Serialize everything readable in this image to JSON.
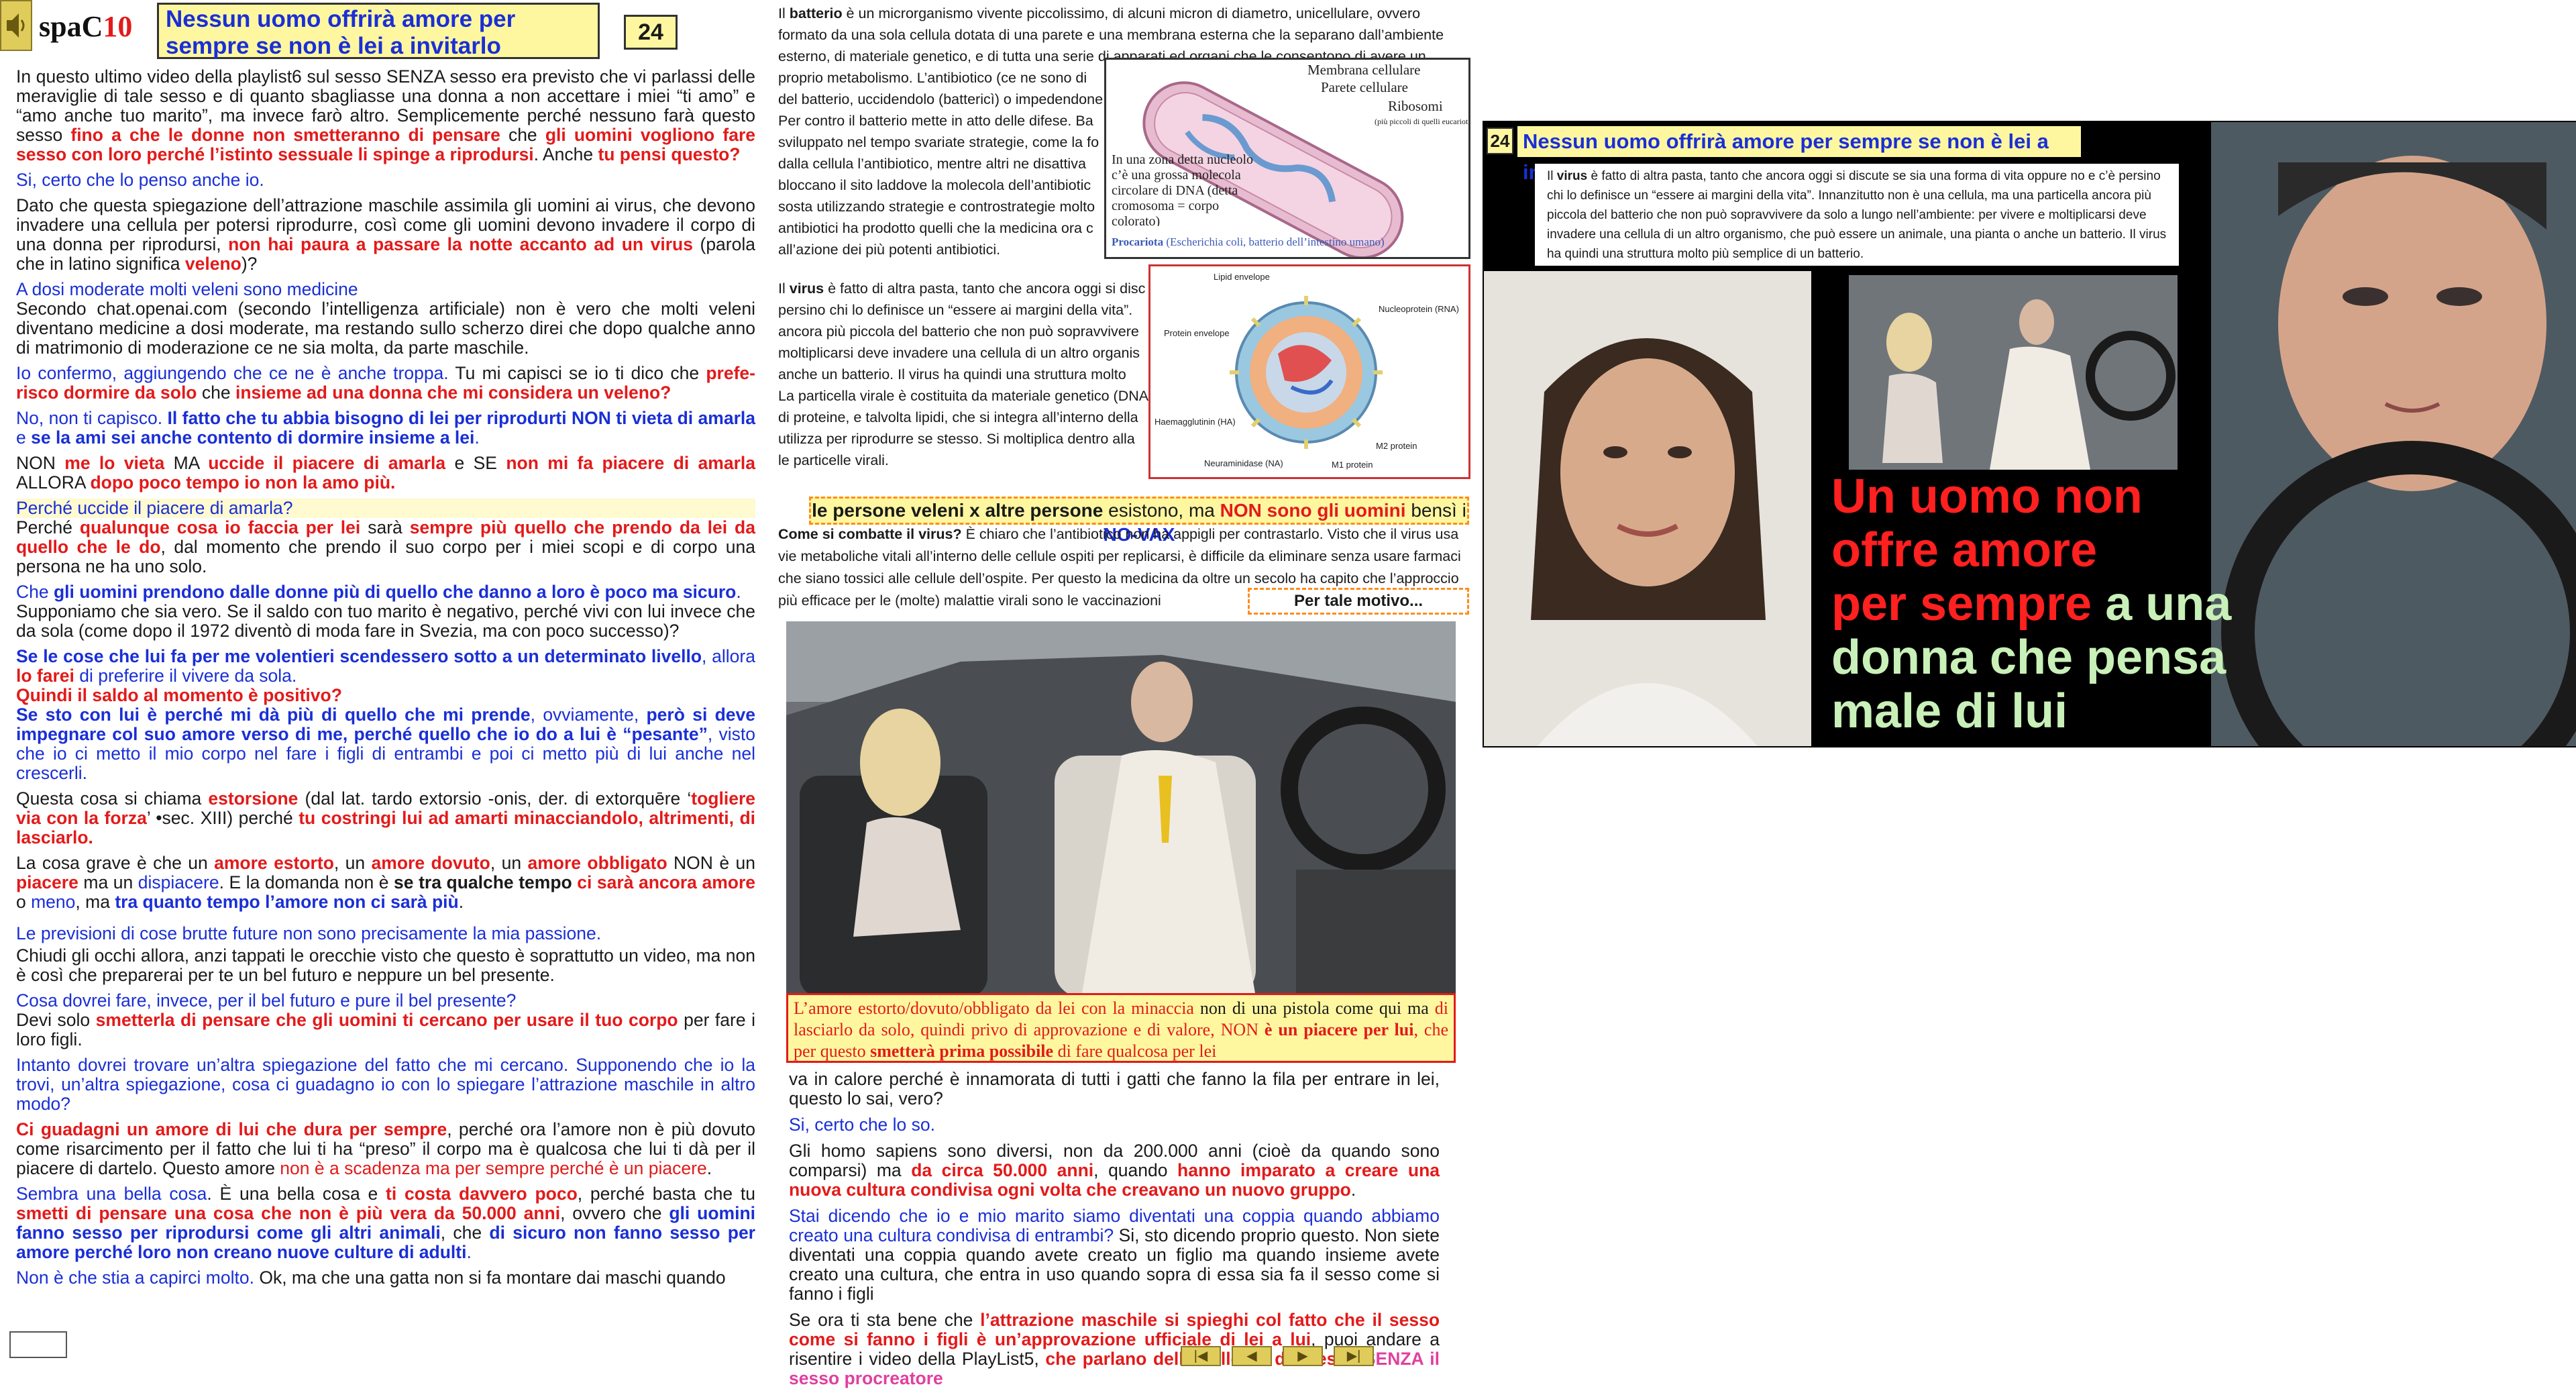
{
  "header": {
    "brand": "spaC",
    "brand_num": "10",
    "title": "Nessun uomo offrirà amore per sempre se non è lei a invitarlo",
    "page": "24"
  },
  "left": {
    "p1a": "In questo ultimo video della playlist6 sul sesso SENZA sesso era previsto che vi parlassi delle meraviglie di tale sesso e di quanto sbagliasse una donna a non accettare i miei “ti amo” e “amo anche tuo marito”, ma invece farò altro. Semplicemente perché nessuno farà questo sesso ",
    "p1b": "fino a che le donne non smetteranno di pensare",
    "p1c": " che ",
    "p1d": "gli uomini vogliono fare sesso con loro perché l’istinto sessuale li spinge a riprodursi",
    "p1e": ". Anche ",
    "p1f": "tu pensi questo?",
    "p2": "Si, certo che lo penso anche io.",
    "p3a": "Dato che questa spiegazione dell’attrazione maschile assimila gli uomini ai virus, che devono invadere una cellula per potersi riprodurre, così come gli uomini devono invadere il corpo di una donna per riprodursi, ",
    "p3b": "non hai paura a passare la notte accanto ad un virus",
    "p3c": " (parola che in latino significa ",
    "p3d": "veleno",
    "p3e": ")?",
    "p4": "A dosi moderate molti veleni sono medicine",
    "p5": "Secondo chat.openai.com (secondo l’intelligenza artificiale) non è vero che molti veleni diventano medicine a dosi moderate, ma restando sullo scherzo direi che dopo qualche anno di matrimonio di moderazione ce ne sia molta, da parte maschile.",
    "p6a": "Io confermo, aggiungendo che ce ne è anche troppa.",
    "p6b": " Tu mi capisci se io ti dico che ",
    "p6c": "prefe-risco dormire da solo",
    "p6d": " che ",
    "p6e": "insieme ad una donna che mi considera un veleno?",
    "p7a": "No, non ti capisco. ",
    "p7b": "Il fatto che tu abbia bisogno di lei per riprodurti NON ti vieta di amarla",
    "p7c": " e ",
    "p7d": "se la ami sei anche contento di dormire insieme a lei",
    "p7e": ".",
    "p8a": "NON ",
    "p8b": "me lo vieta",
    "p8c": " MA ",
    "p8d": "uccide il piacere di amarla",
    "p8e": " e SE ",
    "p8f": "non mi fa piacere di amarla",
    "p8g": " ALLORA ",
    "p8h": "dopo poco tempo io non la amo più.",
    "p9": "Perché uccide il piacere di amarla?",
    "p10a": "Perché ",
    "p10b": "qualunque cosa io faccia per lei",
    "p10c": " sarà ",
    "p10d": "sempre più quello che prendo da lei da quello che le do",
    "p10e": ", dal momento che prendo il suo corpo per i miei scopi e di corpo una persona ne ha uno solo.",
    "p11a": "Che ",
    "p11b": "gli uomini prendono dalle donne più di quello che danno a loro è poco ma sicuro",
    "p11c": ".",
    "p12": "Supponiamo che sia vero. Se il saldo con tuo marito è negativo, perché vivi con lui invece che da sola (come dopo il 1972 diventò di moda fare in Svezia, ma con poco successo)?",
    "p13a": "Se le cose che lui fa per me volentieri scendessero sotto a un determinato livello",
    "p13b": ", allora ",
    "p13c": "lo farei",
    "p13d": " di preferire il vivere da sola.",
    "p14": "Quindi il saldo al momento è positivo?",
    "p15a": "Se sto con lui è perché mi dà più di quello che mi prende",
    "p15b": ", ovviamente, ",
    "p15c": "però si deve impegnare col suo amore verso di me, perché quello che io do a lui è “pesante”",
    "p15d": ", visto che io ci metto il mio corpo nel fare i figli di entrambi e poi ci metto più di lui anche nel crescerli.",
    "p16a": "Questa cosa si chiama ",
    "p16b": "estorsione",
    "p16c": " (dal lat. tardo extorsio -onis, der. di extorquēre ‘",
    "p16d": "togliere via con la forza",
    "p16e": "’ •sec. XIII) perché ",
    "p16f": "tu costringi lui ad amarti minacciandolo, altrimenti, di lasciarlo.",
    "p17a": "La cosa grave è che un ",
    "p17b": "amore estorto",
    "p17c": ", un ",
    "p17d": "amore dovuto",
    "p17e": ", un ",
    "p17f": "amore obbligato",
    "p17g": " NON è un ",
    "p17h": "piacere",
    "p17i": " ma un ",
    "p17j": "dispiacere",
    "p17k": ". E la domanda non è ",
    "p17l": "se tra qualche tempo",
    "p17m": " ",
    "p17n": "ci sarà ancora amore",
    "p17o": " o ",
    "p17p": "meno",
    "p17q": ", ma ",
    "p17r": "tra quanto tempo l’amore non ci sarà più",
    "p17s": ".",
    "p18": "Le previsioni di cose brutte future non sono precisamente la mia passione.",
    "p19": "Chiudi gli occhi allora, anzi tappati le orecchie visto che questo è soprattutto un video, ma non è così che preparerai per te un bel futuro e neppure un bel presente.",
    "p20": "Cosa dovrei fare, invece, per il bel futuro e pure il bel presente?",
    "p21a": "Devi solo ",
    "p21b": "smetterla di pensare che gli uomini ti cercano per usare il tuo corpo",
    "p21c": " per fare i loro figli.",
    "p22": "Intanto dovrei trovare un’altra spiegazione del fatto che mi cercano. Supponendo che io la trovi, un’altra spiegazione, cosa ci guadagno io con lo spiegare l’attrazione maschile in altro modo?",
    "p23a": "Ci guadagni un amore di lui che dura per sempre",
    "p23b": ", perché ora l’amore non è più dovuto come risarcimento per il fatto che lui ti ha “preso” il corpo ma è qualcosa che lui ti dà per il piacere di dartelo. Questo amore ",
    "p23c": "non è a scadenza ma per sempre perché è un piacere",
    "p23d": ".",
    "p24a": "Sembra una bella cosa",
    "p24b": ". È una bella cosa e ",
    "p24c": "ti costa davvero poco",
    "p24d": ", perché basta che tu ",
    "p24e": "smetti di pensare una cosa che non è più vera da 50.000 anni",
    "p24f": ", ovvero che ",
    "p24g": "gli uomini fanno sesso per riprodursi come gli altri animali",
    "p24h": ", che ",
    "p24i": "di sicuro non fanno sesso per amore perché loro non creano nuove culture di adulti",
    "p24j": ".",
    "p25a": "Non è che stia a capirci molto.",
    "p25b": " Ok, ma che una gatta non si fa montare dai maschi quando"
  },
  "middle": {
    "bact_a": "Il ",
    "bact_b": "batterio",
    "bact_c": " è un microrganismo vivente piccolissimo, di alcuni micron di diametro, unicellulare, ovvero formato da una sola cellula dotata di una parete e una membrana esterna che la separano dall’ambiente esterno, di materiale genetico, e di tutta una serie di apparati ed organi che le consentono di avere un proprio metabolismo. L’antibiotico (ce ne sono di",
    "bact_d": "del batterio, uccidendolo (battericì) o impedendone",
    "bact_e": "Per contro il batterio mette in atto delle difese. Ba",
    "bact_f": "sviluppato nel tempo svariate strategie, come la fo",
    "bact_g": "dalla cellula l’antibiotico, mentre altri ne disattiva",
    "bact_h": "bloccano il sito laddove la molecola dell’antibiotic",
    "bact_i": "sosta utilizzando strategie e controstrategie molto",
    "bact_j": "antibiotici ha prodotto quelli che la medicina ora c",
    "bact_k": "all’azione dei più potenti antibiotici.",
    "vir_a": "Il ",
    "vir_b": "virus",
    "vir_c": " è fatto di altra pasta, tanto che ancora oggi si disc",
    "vir_d": "persino chi lo definisce un “essere ai margini della vita”.",
    "vir_e": "ancora più piccola del batterio che non può sopravvivere",
    "vir_f": "moltiplicarsi deve invadere una cellula di un altro organis",
    "vir_g": "anche un batterio. Il virus ha quindi una struttura molto",
    "vir_h": "La particella virale è costituita da materiale genetico (DNA",
    "vir_i": "di proteine, e talvolta lipidi, che si integra all’interno della",
    "vir_j": "utilizza per riprodurre se stesso. Si moltiplica dentro alla",
    "vir_k": "le particelle virali.",
    "bact_fig": {
      "l1": "Membrana cellulare",
      "l2": "Parete cellulare",
      "l3": "Ribosomi",
      "l4": "(più piccoli di quelli eucarioti)",
      "l5": "In una zona detta nucleolo c’è una grossa molecola circolare  di DNA (detta cromosoma = corpo colorato)",
      "cap_a": "Procariota",
      "cap_b": " (Escherichia coli, batterio dell’intestino umano)"
    },
    "virus_fig": {
      "l1": "Lipid envelope",
      "l2": "Nucleoprotein (RNA)",
      "l3": "Protein envelope",
      "l4": "Haemagglutinin (HA)",
      "l5": "M2 protein",
      "l6": "Neuraminidase (NA)",
      "l7": "M1 protein"
    },
    "veleni_a": "le persone veleni x altre persone",
    "veleni_b": " esistono, ma ",
    "veleni_c": "NON sono gli uomini",
    "veleni_d": " bensì i ",
    "veleni_e": "NO-VAX",
    "comb_a": "Come si combatte il virus?",
    "comb_b": " È chiaro che l’antibiotico non ha appigli per contrastarlo. Visto che il virus usa vie metaboliche vitali all’interno delle cellule ospiti per replicarsi, è difficile da eliminare senza usare farmaci che siano tossici alle cellule dell’ospite. Per questo la medicina da oltre un secolo ha capito che l’approccio più efficace per le (molte) malattie virali sono le vaccinazioni",
    "tale": "Per tale motivo...",
    "cap_a": "L’amore estorto/dovuto/obbligato da lei con la minaccia",
    "cap_b": " non di una pistola come qui ma ",
    "cap_c": "di lasciarlo da solo, quindi privo di approvazione e di valore, NON ",
    "cap_d": "è un piacere per lui",
    "cap_e": ", che per questo ",
    "cap_f": "smetterà prima possibile",
    "cap_g": " di fare qualcosa per lei",
    "lo1": "va in calore perché è innamorata di tutti i gatti che fanno la fila per entrare in lei, questo lo sai, vero?",
    "lo2": "Si, certo che lo so.",
    "lo3a": "Gli homo sapiens sono diversi, non da 200.000 anni (cioè da quando sono comparsi) ma ",
    "lo3b": "da circa 50.000 anni",
    "lo3c": ", quando ",
    "lo3d": "hanno imparato a creare una nuova cultura condivisa  ogni volta che creavano un nuovo gruppo",
    "lo3e": ".",
    "lo4a": "Stai dicendo che io e mio marito siamo diventati una coppia quando abbiamo creato una cultura condivisa di entrambi?",
    "lo4b": " Si, sto dicendo proprio questo. Non siete diventati una coppia quando avete creato un figlio ma quando insieme avete creato una cultura, che entra in uso quando sopra di essa sia fa il sesso come si fanno i figli",
    "lo5a": "Se ora ti sta bene che ",
    "lo5b": "l’attrazione maschile si spieghi col fatto che il sesso come si fanno i figli è un’approvazione ufficiale di lei a lui",
    "lo5c": ", puoi andare a risentire i video della PlayList5, ",
    "lo5d": "che parlano delle bellezze del sesso ",
    "lo5e": "SENZA il sesso procreatore"
  },
  "thumb": {
    "num": "24",
    "title": "Nessun uomo offrirà amore per sempre se non è lei a invitarlo",
    "text_a": "Il ",
    "text_b": "virus",
    "text_c": " è fatto di altra pasta, tanto che ancora oggi si discute se sia una forma di vita oppure no e c’è persino chi lo definisce un “essere ai margini della vita”. Innanzitutto non è una cellula, ma una particella ancora più piccola del batterio che non può sopravvivere da solo a lungo nell’ambiente: per vivere e moltiplicarsi deve invadere una cellula di un altro organismo, che può essere un animale, una pianta o anche un batterio. Il virus ha quindi una struttura molto più semplice di un batterio.",
    "slogan_r1": "Un uomo non",
    "slogan_r2": "offre amore",
    "slogan_r3": "per sempre",
    "slogan_g1": " a una",
    "slogan_g2": "donna che pensa",
    "slogan_g3": "male di lui"
  },
  "nav": {
    "first": "|◀",
    "prev": "◀",
    "next": "▶",
    "last": "▶|"
  },
  "colors": {
    "accent_red": "#e31a1a",
    "accent_blue": "#1a2fd6",
    "highlight_yellow": "#fff7a0",
    "slogan_green": "#c8f0b8"
  }
}
